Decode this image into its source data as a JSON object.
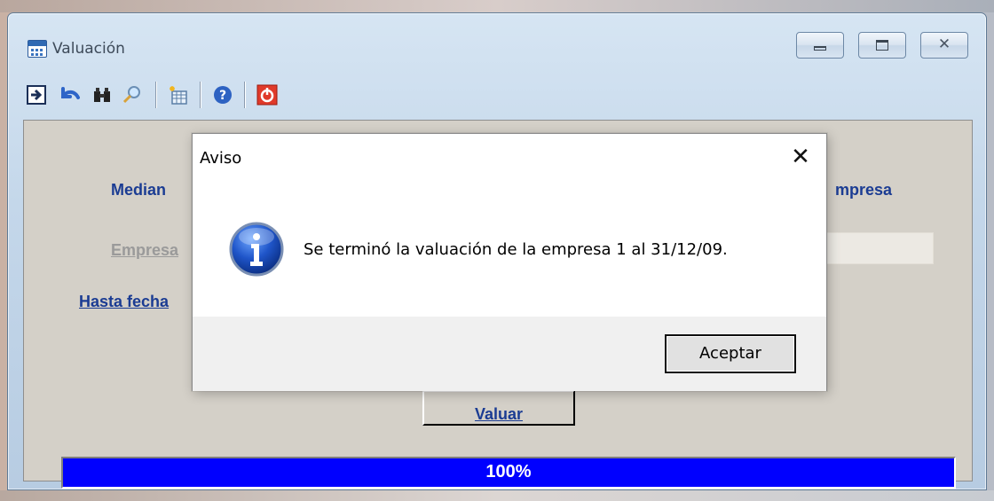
{
  "window": {
    "title": "Valuación",
    "minimize": "minimize",
    "maximize": "maximize",
    "close": "close"
  },
  "toolbar": {
    "icons": [
      "arrow-right-icon",
      "undo-icon",
      "binoculars-icon",
      "magnifier-icon",
      "new-sheet-icon",
      "help-icon",
      "power-icon"
    ]
  },
  "form": {
    "desc_prefix": "Median",
    "desc_suffix": "mpresa",
    "empresa_label": "Empresa",
    "hasta_fecha_label": "Hasta fecha",
    "valuar_button": "Valuar"
  },
  "progress": {
    "value": 1.0,
    "label": "100%"
  },
  "dialog": {
    "title": "Aviso",
    "message": "Se terminó la valuación de la empresa 1 al 31/12/09.",
    "ok_button": "Aceptar"
  },
  "colors": {
    "progress": "#0000ff",
    "label_blue": "#1b3c93",
    "face": "#d4d0c8"
  }
}
